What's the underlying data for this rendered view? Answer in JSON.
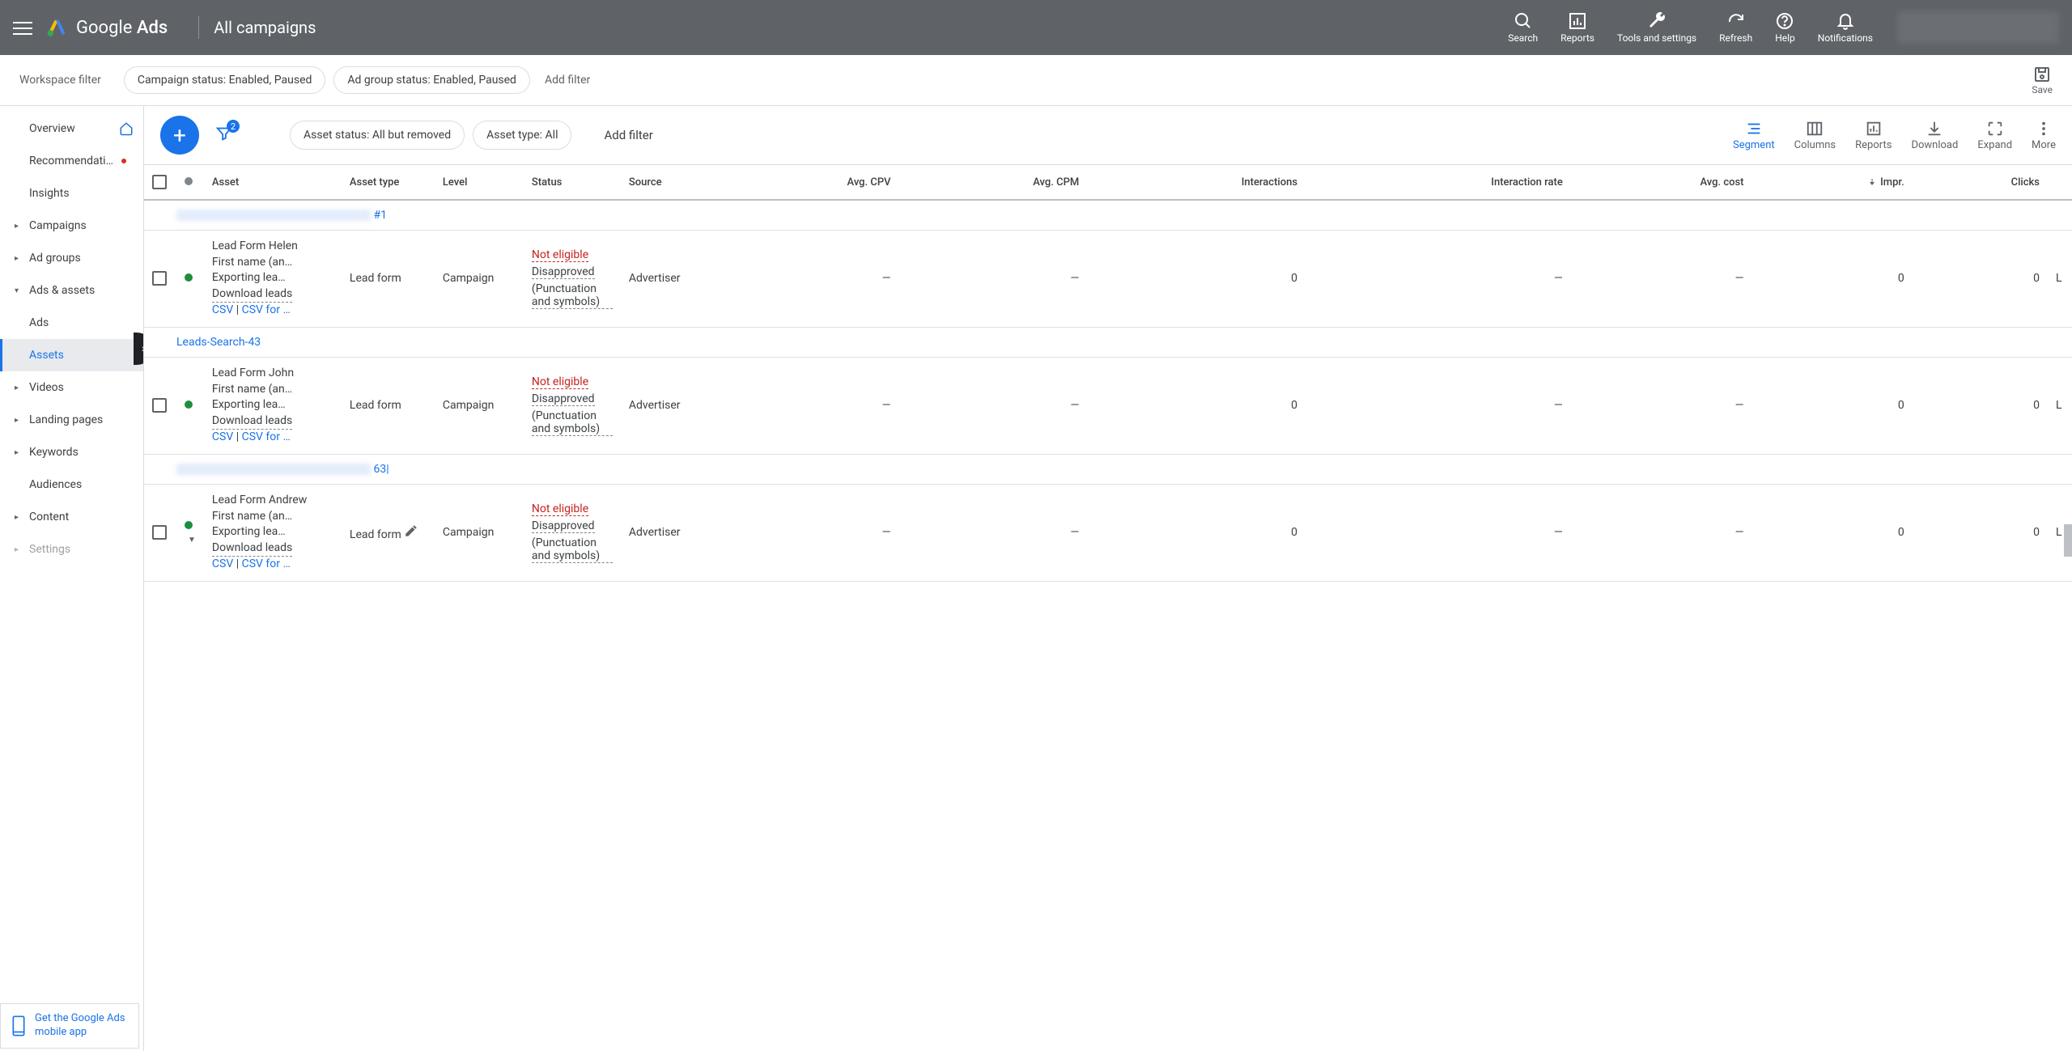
{
  "header": {
    "brand": "Google",
    "product": "Ads",
    "title": "All campaigns",
    "tools": {
      "search": "Search",
      "reports": "Reports",
      "tools": "Tools and settings",
      "refresh": "Refresh",
      "help": "Help",
      "notifications": "Notifications"
    }
  },
  "filterBar": {
    "label": "Workspace filter",
    "chips": {
      "campaign": "Campaign status: Enabled, Paused",
      "adgroup": "Ad group status: Enabled, Paused"
    },
    "addFilter": "Add filter",
    "save": "Save"
  },
  "sidebar": {
    "overview": "Overview",
    "recommendations": "Recommendations",
    "insights": "Insights",
    "campaigns": "Campaigns",
    "adgroups": "Ad groups",
    "adsassets": "Ads & assets",
    "ads": "Ads",
    "assets": "Assets",
    "videos": "Videos",
    "landing": "Landing pages",
    "keywords": "Keywords",
    "audiences": "Audiences",
    "content": "Content",
    "settings": "Settings"
  },
  "toolbar": {
    "filterBadge": "2",
    "assetStatus": "Asset status: All but removed",
    "assetType": "Asset type: All",
    "addFilter": "Add filter",
    "actions": {
      "segment": "Segment",
      "columns": "Columns",
      "reports": "Reports",
      "download": "Download",
      "expand": "Expand",
      "more": "More"
    }
  },
  "table": {
    "headers": {
      "asset": "Asset",
      "assetType": "Asset type",
      "level": "Level",
      "status": "Status",
      "source": "Source",
      "avgCpv": "Avg. CPV",
      "avgCpm": "Avg. CPM",
      "interactions": "Interactions",
      "interactionRate": "Interaction rate",
      "avgCost": "Avg. cost",
      "impr": "Impr.",
      "clicks": "Clicks"
    },
    "groups": [
      {
        "linkSuffix": "#1"
      },
      {
        "link": "Leads-Search-43"
      },
      {
        "linkSuffix": "63|"
      }
    ],
    "rows": [
      {
        "asset": {
          "title": "Lead Form Helen",
          "fields": "First name (an…",
          "exporting": "Exporting lea…",
          "download": "Download leads",
          "csv": "CSV",
          "csvFor": "CSV for …"
        },
        "assetType": "Lead form",
        "level": "Campaign",
        "status": {
          "notEligible": "Not eligible",
          "disapproved": "Disapproved",
          "reason": "(Punctuation and symbols)"
        },
        "source": "Advertiser",
        "avgCpv": "—",
        "avgCpm": "—",
        "interactions": "0",
        "interactionRate": "—",
        "avgCost": "—",
        "impr": "0",
        "clicks": "0"
      },
      {
        "asset": {
          "title": "Lead Form John",
          "fields": "First name (an…",
          "exporting": "Exporting lea…",
          "download": "Download leads",
          "csv": "CSV",
          "csvFor": "CSV for …"
        },
        "assetType": "Lead form",
        "level": "Campaign",
        "status": {
          "notEligible": "Not eligible",
          "disapproved": "Disapproved",
          "reason": "(Punctuation and symbols)"
        },
        "source": "Advertiser",
        "avgCpv": "—",
        "avgCpm": "—",
        "interactions": "0",
        "interactionRate": "—",
        "avgCost": "—",
        "impr": "0",
        "clicks": "0"
      },
      {
        "asset": {
          "title": "Lead Form Andrew",
          "fields": "First name (an…",
          "exporting": "Exporting lea…",
          "download": "Download leads",
          "csv": "CSV",
          "csvFor": "CSV for …"
        },
        "assetType": "Lead form",
        "level": "Campaign",
        "status": {
          "notEligible": "Not eligible",
          "disapproved": "Disapproved",
          "reason": "(Punctuation and symbols)"
        },
        "source": "Advertiser",
        "avgCpv": "—",
        "avgCpm": "—",
        "interactions": "0",
        "interactionRate": "—",
        "avgCost": "—",
        "impr": "0",
        "clicks": "0",
        "hoverEdit": true,
        "caret": true
      }
    ]
  },
  "mobilePromo": "Get the Google Ads mobile app"
}
